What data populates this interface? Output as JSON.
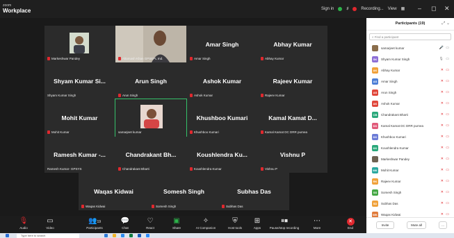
{
  "titlebar": {
    "brand_small": "zoom",
    "brand": "Workplace",
    "signin": "Sign in",
    "recording": "Recording...",
    "view": "View"
  },
  "tiles": [
    {
      "name": "",
      "sub": "Markeshwar Pandey",
      "kind": "video"
    },
    {
      "name": "",
      "sub": "Altamash Khan GPSEPL Ind.",
      "kind": "video"
    },
    {
      "name": "Amar Singh",
      "sub": "Amar Singh",
      "kind": "name"
    },
    {
      "name": "Abhay Kumar",
      "sub": "Abhay Kumar",
      "kind": "name"
    },
    {
      "name": "Shyam Kumar Si...",
      "sub": "Shyam Kumar Singh",
      "kind": "name"
    },
    {
      "name": "Arun Singh",
      "sub": "Arun Singh",
      "kind": "name"
    },
    {
      "name": "Ashok Kumar",
      "sub": "Ashok Kumar",
      "kind": "name"
    },
    {
      "name": "Rajeev Kumar",
      "sub": "Rajeev Kumar",
      "kind": "name"
    },
    {
      "name": "Mohit Kumar",
      "sub": "Mohit Kumar",
      "kind": "name"
    },
    {
      "name": "",
      "sub": "samarjeet kumar",
      "kind": "video"
    },
    {
      "name": "Khushboo Kumari",
      "sub": "Khushboo Kumari",
      "kind": "name"
    },
    {
      "name": "Kamal Kamat D...",
      "sub": "Kamal Kamat DC DRR purnea",
      "kind": "name"
    },
    {
      "name": "Ramesh Kumar -...",
      "sub": "Ramesh Kumar- GPSYS",
      "kind": "name"
    },
    {
      "name": "Chandrakant Bh...",
      "sub": "Chandrakant Bharti",
      "kind": "name"
    },
    {
      "name": "Koushlendra Ku...",
      "sub": "Koushlendra Kumar",
      "kind": "name"
    },
    {
      "name": "Vishnu P",
      "sub": "Vishnu P",
      "kind": "name"
    },
    {
      "name": "Waqas Kidwai",
      "sub": "Waqas Kidwai",
      "kind": "name"
    },
    {
      "name": "Somesh Singh",
      "sub": "Somesh Singh",
      "kind": "name"
    },
    {
      "name": "Subhas Das",
      "sub": "Subhas Das",
      "kind": "name"
    }
  ],
  "toolbar": {
    "audio": "Audio",
    "video": "Video",
    "participants": "Participants",
    "participants_count": "19",
    "chat": "Chat",
    "react": "React",
    "share": "Share",
    "ai_companion": "AI Companion",
    "host_tools": "Host tools",
    "apps": "Apps",
    "pause_stop": "Pause/stop recording",
    "more": "More",
    "end": "End"
  },
  "panel": {
    "title": "Participants (19)",
    "search_placeholder": "Find a participant",
    "participants": [
      {
        "initials": "",
        "name": "samarjeet kumar",
        "color": "#8a6d4b"
      },
      {
        "initials": "SK",
        "name": "Shyam Kumar Singh",
        "color": "#8e6fd6"
      },
      {
        "initials": "AK",
        "name": "Abhay Kumar",
        "color": "#f0a13a"
      },
      {
        "initials": "AS",
        "name": "Amar Singh",
        "color": "#4d7fd6"
      },
      {
        "initials": "AS",
        "name": "Arun Singh",
        "color": "#e0463a"
      },
      {
        "initials": "AK",
        "name": "Ashok Kumar",
        "color": "#e0463a"
      },
      {
        "initials": "CB",
        "name": "Chandrakant Bharti",
        "color": "#2aa87b"
      },
      {
        "initials": "KK",
        "name": "Kamal Kamat DC DRR purnea",
        "color": "#e05a7a"
      },
      {
        "initials": "KK",
        "name": "Khushboo Kumari",
        "color": "#6b7bd6"
      },
      {
        "initials": "KK",
        "name": "Koushlendra Kumar",
        "color": "#2aa87b"
      },
      {
        "initials": "",
        "name": "Markeshwar Pandey",
        "color": "#6d6252"
      },
      {
        "initials": "MK",
        "name": "Mohit Kumar",
        "color": "#2aa8a0"
      },
      {
        "initials": "RK",
        "name": "Rajeev Kumar",
        "color": "#f0a13a"
      },
      {
        "initials": "SS",
        "name": "Somesh Singh",
        "color": "#45a845"
      },
      {
        "initials": "SD",
        "name": "Subhas Das",
        "color": "#f0a13a"
      },
      {
        "initials": "WK",
        "name": "Waqas Kidwai",
        "color": "#e07a3a"
      }
    ],
    "invite": "Invite",
    "mute_all": "Mute all",
    "more": "..."
  },
  "taskbar": {
    "search": "Type here to search"
  }
}
